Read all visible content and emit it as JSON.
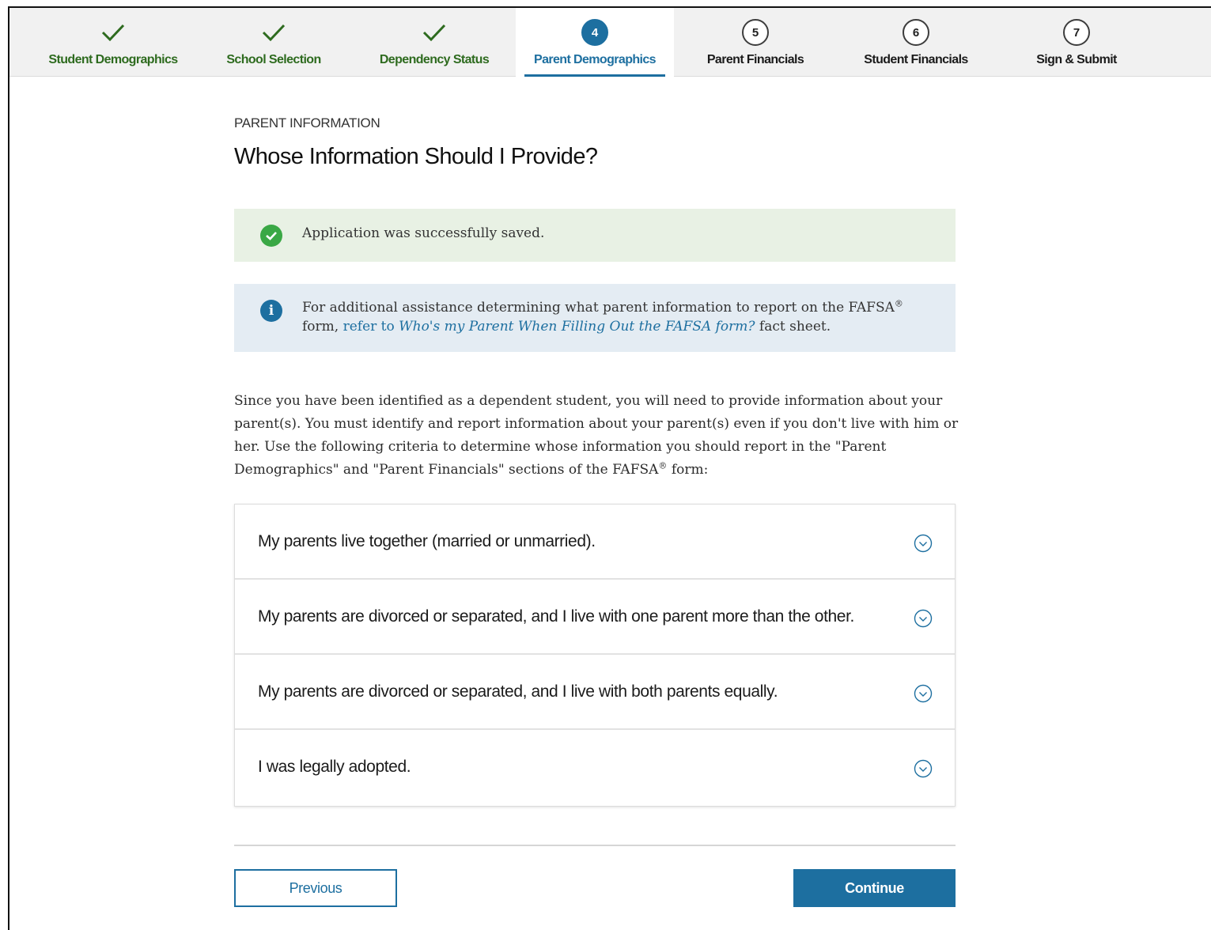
{
  "steps": [
    {
      "label": "Student Demographics",
      "state": "done",
      "icon": "check-icon"
    },
    {
      "label": "School Selection",
      "state": "done",
      "icon": "check-icon"
    },
    {
      "label": "Dependency Status",
      "state": "done",
      "icon": "check-icon"
    },
    {
      "label": "Parent Demographics",
      "state": "current",
      "number": "4"
    },
    {
      "label": "Parent Financials",
      "state": "upcoming",
      "number": "5"
    },
    {
      "label": "Student Financials",
      "state": "upcoming",
      "number": "6"
    },
    {
      "label": "Sign & Submit",
      "state": "upcoming",
      "number": "7"
    }
  ],
  "page": {
    "eyebrow": "PARENT INFORMATION",
    "title": "Whose Information Should I Provide?"
  },
  "alerts": {
    "success": {
      "text": "Application was successfully saved.",
      "icon": "check-circle-icon"
    },
    "info": {
      "text_before": "For additional assistance determining what parent information to report on the FAFSA",
      "registered": "®",
      "text_form": "form,",
      "link_prefix": "refer to",
      "link_title": "Who's my Parent When Filling Out the FAFSA form?",
      "text_after": "fact sheet.",
      "icon": "info-icon"
    }
  },
  "intro": {
    "text": "Since you have been identified as a dependent student, you will need to provide information about your parent(s). You must identify and report information about your parent(s) even if you don't live with him or her. Use the following criteria to determine whose information you should report in the \"Parent Demographics\" and \"Parent Financials\" sections of the FAFSA",
    "registered": "®",
    "tail": "form:"
  },
  "accordion": [
    {
      "label": "My parents live together (married or unmarried)."
    },
    {
      "label": "My parents are divorced or separated, and I live with one parent more than the other."
    },
    {
      "label": "My parents are divorced or separated, and I live with both parents equally."
    },
    {
      "label": "I was legally adopted."
    }
  ],
  "buttons": {
    "previous": "Previous",
    "continue": "Continue"
  },
  "colors": {
    "primary": "#1d6fa0",
    "done_green": "#2e6b1f",
    "success_bg": "#e8f1e4",
    "info_bg": "#e4ecf3"
  }
}
